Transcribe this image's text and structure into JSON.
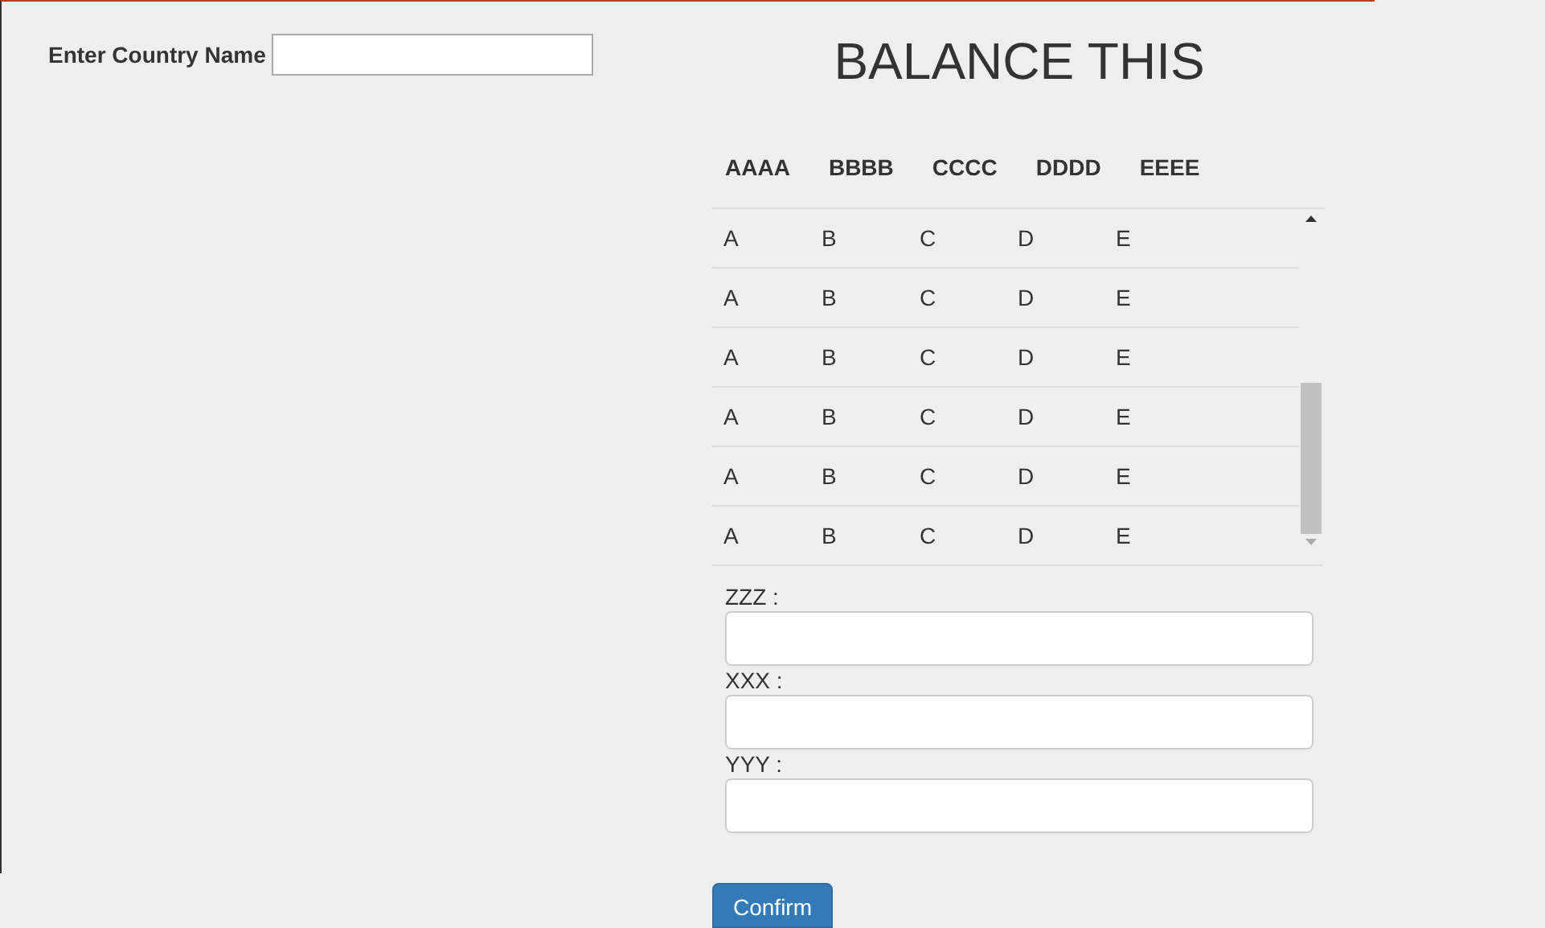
{
  "country_field": {
    "label": "Enter Country Name"
  },
  "title": "BALANCE THIS",
  "table": {
    "columns": [
      "AAAA",
      "BBBB",
      "CCCC",
      "DDDD",
      "EEEE"
    ],
    "rows": [
      [
        "A",
        "B",
        "C",
        "D",
        "E"
      ],
      [
        "A",
        "B",
        "C",
        "D",
        "E"
      ],
      [
        "A",
        "B",
        "C",
        "D",
        "E"
      ],
      [
        "A",
        "B",
        "C",
        "D",
        "E"
      ],
      [
        "A",
        "B",
        "C",
        "D",
        "E"
      ],
      [
        "A",
        "B",
        "C",
        "D",
        "E"
      ]
    ]
  },
  "fields": [
    {
      "label": "ZZZ :"
    },
    {
      "label": "XXX :"
    },
    {
      "label": "YYY :"
    }
  ],
  "confirm_button": "Confirm"
}
